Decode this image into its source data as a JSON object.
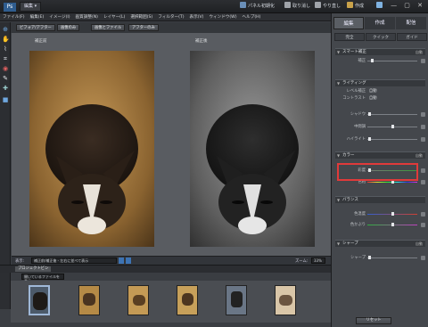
{
  "titlebar": {
    "logo": "Ps",
    "mode": "編集",
    "buttons": [
      "パネル初期化",
      "取り消し",
      "やり直し",
      "作成",
      "ホーム"
    ],
    "win": "— ▢ ✕"
  },
  "menu": [
    "ファイル(F)",
    "編集(E)",
    "イメージ(I)",
    "画質調整(N)",
    "レイヤー(L)",
    "選択範囲(S)",
    "フィルター(T)",
    "表示(V)",
    "ウィンドウ(W)",
    "ヘルプ(H)"
  ],
  "modes": [
    "ビフォア/アフター",
    "画像のみ",
    "画像とファイル",
    "アフターのみ"
  ],
  "canvas": {
    "before_label": "補正前",
    "after_label": "補正後"
  },
  "zoombar": {
    "label": "表示:",
    "view": "補正前/補正後 - 左右に並べて表示",
    "zoom_label": "ズーム:",
    "zoom": "33%"
  },
  "bin": {
    "title": "プロジェクトビン",
    "option": "開いているファイルを表示"
  },
  "thumbs": 6,
  "right": {
    "tabs": [
      "編集",
      "作成",
      "配信"
    ],
    "subtabs": [
      "完全",
      "クイック",
      "ガイド"
    ],
    "sections": [
      {
        "title": "スマート補正",
        "rt": "自動",
        "rows": [
          {
            "label": "補正",
            "knob": 0.08
          }
        ]
      },
      {
        "title": "ライティング",
        "rows": [
          {
            "label": "レベル補正",
            "value": "自動"
          },
          {
            "label": "コントラスト",
            "value": "自動"
          },
          {
            "label": "シャドウ",
            "knob": 0.02
          },
          {
            "label": "中間調",
            "knob": 0.5
          },
          {
            "label": "ハイライト",
            "knob": 0.02
          }
        ]
      },
      {
        "title": "カラー",
        "rt": "自動",
        "rows": [
          {
            "label": "彩度",
            "knob": 0.02
          },
          {
            "label": "色相",
            "knob": 0.5
          }
        ]
      },
      {
        "title": "バランス",
        "rows": [
          {
            "label": "色温度",
            "knob": 0.5
          },
          {
            "label": "色かぶり",
            "knob": 0.5
          }
        ]
      },
      {
        "title": "シャープ",
        "rt": "自動",
        "rows": [
          {
            "label": "シャープ",
            "knob": 0.02
          }
        ]
      }
    ],
    "reset": "リセット"
  },
  "colors": {
    "accent": "#3a6ea5",
    "highlight": "#e03a3a"
  }
}
